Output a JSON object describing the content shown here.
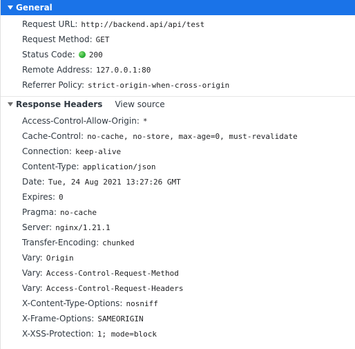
{
  "general": {
    "title": "General",
    "rows": [
      {
        "name": "Request URL:",
        "value": "http://backend.api/api/test"
      },
      {
        "name": "Request Method:",
        "value": "GET"
      },
      {
        "name": "Status Code:",
        "value": "200",
        "status_color": "#2fb33a"
      },
      {
        "name": "Remote Address:",
        "value": "127.0.0.1:80"
      },
      {
        "name": "Referrer Policy:",
        "value": "strict-origin-when-cross-origin"
      }
    ]
  },
  "response_headers": {
    "title": "Response Headers",
    "view_source_label": "View source",
    "rows": [
      {
        "name": "Access-Control-Allow-Origin:",
        "value": "*"
      },
      {
        "name": "Cache-Control:",
        "value": "no-cache, no-store, max-age=0, must-revalidate"
      },
      {
        "name": "Connection:",
        "value": "keep-alive"
      },
      {
        "name": "Content-Type:",
        "value": "application/json"
      },
      {
        "name": "Date:",
        "value": "Tue, 24 Aug 2021 13:27:26 GMT"
      },
      {
        "name": "Expires:",
        "value": "0"
      },
      {
        "name": "Pragma:",
        "value": "no-cache"
      },
      {
        "name": "Server:",
        "value": "nginx/1.21.1"
      },
      {
        "name": "Transfer-Encoding:",
        "value": "chunked"
      },
      {
        "name": "Vary:",
        "value": "Origin"
      },
      {
        "name": "Vary:",
        "value": "Access-Control-Request-Method"
      },
      {
        "name": "Vary:",
        "value": "Access-Control-Request-Headers"
      },
      {
        "name": "X-Content-Type-Options:",
        "value": "nosniff"
      },
      {
        "name": "X-Frame-Options:",
        "value": "SAMEORIGIN"
      },
      {
        "name": "X-XSS-Protection:",
        "value": "1; mode=block"
      }
    ]
  },
  "colors": {
    "selected_header_bg": "#1a73e8",
    "status_ok": "#2fb33a"
  },
  "icons": {
    "expand": "triangle-down-icon",
    "status": "status-dot-icon"
  }
}
